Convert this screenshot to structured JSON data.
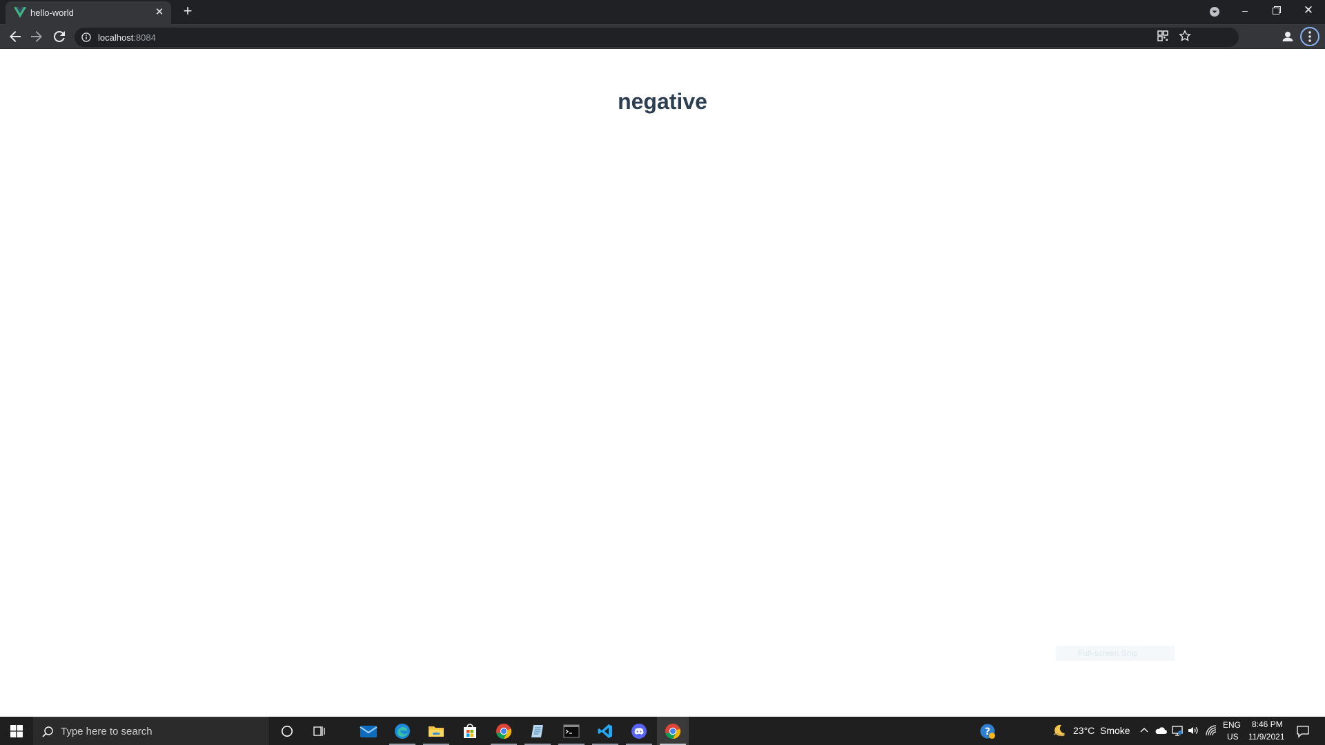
{
  "browser": {
    "tab": {
      "title": "hello-world",
      "favicon": "vue-logo-icon"
    },
    "address": {
      "host": "localhost",
      "port": ":8084"
    }
  },
  "page": {
    "heading": "negative",
    "snip_hint": "Full-screen Snip"
  },
  "taskbar": {
    "search_placeholder": "Type here to search",
    "weather": {
      "temp": "23°C",
      "condition": "Smoke"
    },
    "language": {
      "lang": "ENG",
      "region": "US"
    },
    "clock": {
      "time": "8:46 PM",
      "date": "11/9/2021"
    },
    "apps": [
      "cortana-icon",
      "task-view-icon",
      "mail-icon",
      "edge-icon",
      "file-explorer-icon",
      "store-icon",
      "chrome-icon",
      "notepad-icon",
      "terminal-icon",
      "vscode-icon",
      "discord-icon",
      "chrome-icon"
    ]
  },
  "colors": {
    "heading": "#2c3e50",
    "vue_green": "#41b883",
    "chrome_dark": "#202124"
  }
}
